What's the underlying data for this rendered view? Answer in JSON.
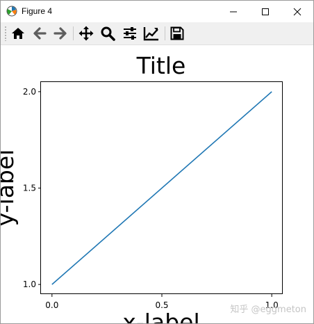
{
  "window": {
    "title": "Figure 4",
    "controls": {
      "minimize": "minimize",
      "maximize": "maximize",
      "close": "close"
    }
  },
  "toolbar": {
    "items": [
      {
        "name": "home",
        "icon": "home-icon"
      },
      {
        "name": "back",
        "icon": "arrow-left-icon"
      },
      {
        "name": "forward",
        "icon": "arrow-right-icon"
      },
      {
        "name": "pan",
        "icon": "move-icon"
      },
      {
        "name": "zoom",
        "icon": "magnifier-icon"
      },
      {
        "name": "configure-subplots",
        "icon": "sliders-icon"
      },
      {
        "name": "edit-axis",
        "icon": "line-chart-icon"
      },
      {
        "name": "save",
        "icon": "floppy-disk-icon"
      }
    ]
  },
  "chart_data": {
    "type": "line",
    "title": "Title",
    "xlabel": "x-label",
    "ylabel": "y-label",
    "x": [
      0.0,
      1.0
    ],
    "series": [
      {
        "values": [
          1.0,
          2.0
        ],
        "color": "#1f77b4"
      }
    ],
    "xlim": [
      -0.05,
      1.05
    ],
    "ylim": [
      0.95,
      2.05
    ],
    "xticks": [
      0.0,
      0.5,
      1.0
    ],
    "xtick_labels": [
      "0.0",
      "0.5",
      "1.0"
    ],
    "yticks": [
      1.0,
      1.5,
      2.0
    ],
    "ytick_labels": [
      "1.0",
      "1.5",
      "2.0"
    ],
    "grid": false
  },
  "watermark": "知乎 @eggmeton",
  "colors": {
    "line": "#1f77b4",
    "toolbar_bg": "#f0f0f0",
    "icon": "#000000"
  }
}
